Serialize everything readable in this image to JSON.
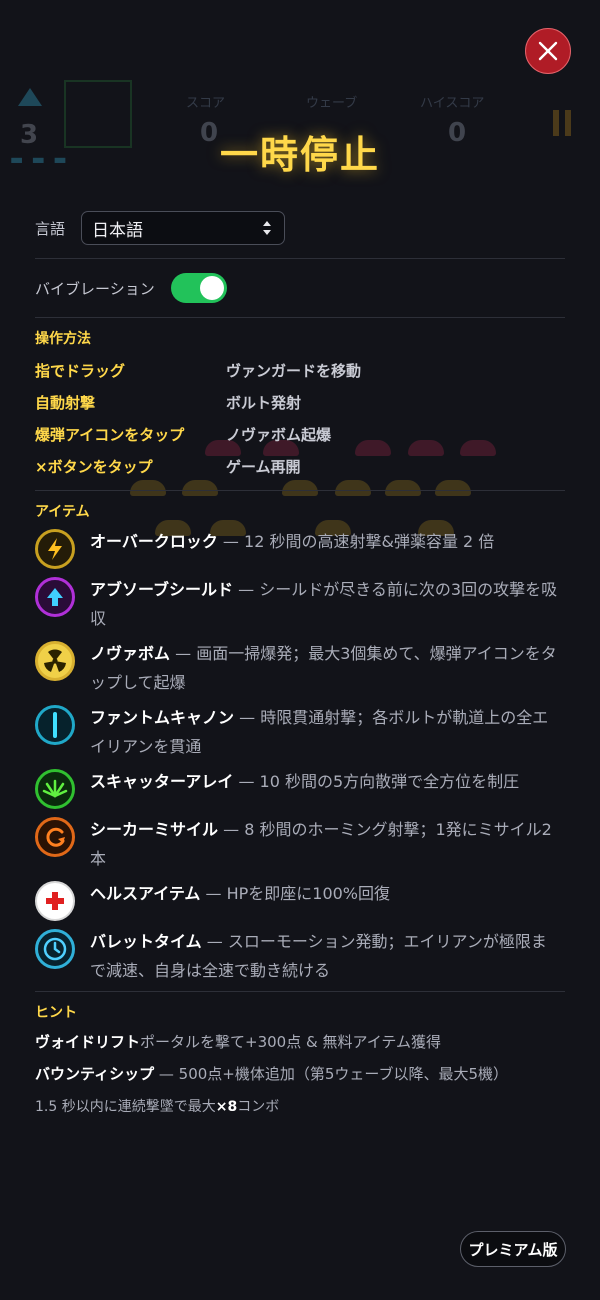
{
  "background_hud": {
    "lives": "3",
    "score_label": "スコア",
    "score_value": "0",
    "wave_label": "ウェーブ",
    "highscore_label": "ハイスコア",
    "highscore_value": "0"
  },
  "title": "一時停止",
  "settings": {
    "language_label": "言語",
    "language_value": "日本語",
    "vibration_label": "バイブレーション",
    "vibration_on": true
  },
  "controls": {
    "title": "操作方法",
    "rows": [
      {
        "key": "指でドラッグ",
        "value": "ヴァンガードを移動"
      },
      {
        "key": "自動射撃",
        "value": "ボルト発射"
      },
      {
        "key": "爆弾アイコンをタップ",
        "value": "ノヴァボム起爆"
      },
      {
        "key": "×ボタンをタップ",
        "value": "ゲーム再開"
      }
    ]
  },
  "items": {
    "title": "アイテム",
    "list": [
      {
        "icon": "lightning-icon",
        "color": "#e0b020",
        "name": "オーバークロック",
        "desc": " — 12 秒間の高速射撃&弾薬容量 2 倍"
      },
      {
        "icon": "shield-arrow-icon",
        "color": "#b030d8",
        "name": "アブソーブシールド",
        "desc": " — シールドが尽きる前に次の3回の攻撃を吸収"
      },
      {
        "icon": "radiation-icon",
        "color": "#d8b030",
        "name": "ノヴァボム",
        "desc": " — 画面一掃爆発；最大3個集めて、爆弾アイコンをタップして起爆"
      },
      {
        "icon": "piercing-bolt-icon",
        "color": "#20a8c8",
        "name": "ファントムキャノン",
        "desc": " — 時限貫通射撃；各ボルトが軌道上の全エイリアンを貫通"
      },
      {
        "icon": "spread-shot-icon",
        "color": "#30c030",
        "name": "スキャッターアレイ",
        "desc": " — 10 秒間の5方向散弾で全方位を制圧"
      },
      {
        "icon": "homing-missile-icon",
        "color": "#e06818",
        "name": "シーカーミサイル",
        "desc": " — 8 秒間のホーミング射撃；1発にミサイル2本"
      },
      {
        "icon": "health-cross-icon",
        "color": "#e02020",
        "name": "ヘルスアイテム",
        "desc": " — HPを即座に100%回復"
      },
      {
        "icon": "clock-icon",
        "color": "#30b0d8",
        "name": "バレットタイム",
        "desc": " — スローモーション発動；エイリアンが極限まで減速、自身は全速で動き続ける"
      }
    ]
  },
  "hints": {
    "title": "ヒント",
    "void_name": "ヴォイドリフト",
    "void_desc": "ポータルを撃て+300点 & 無料アイテム獲得",
    "bounty_name": "バウンティシップ",
    "bounty_desc": " — 500点+機体追加（第5ウェーブ以降、最大5機）",
    "combo_pre": "1.5 秒以内に連続撃墜で最大",
    "combo_mult": "×8",
    "combo_post": "コンボ"
  },
  "premium_label": "プレミアム版",
  "colors": {
    "accent_yellow": "#ffd84a",
    "toggle_green": "#22c25a",
    "close_red": "#b01c26"
  }
}
